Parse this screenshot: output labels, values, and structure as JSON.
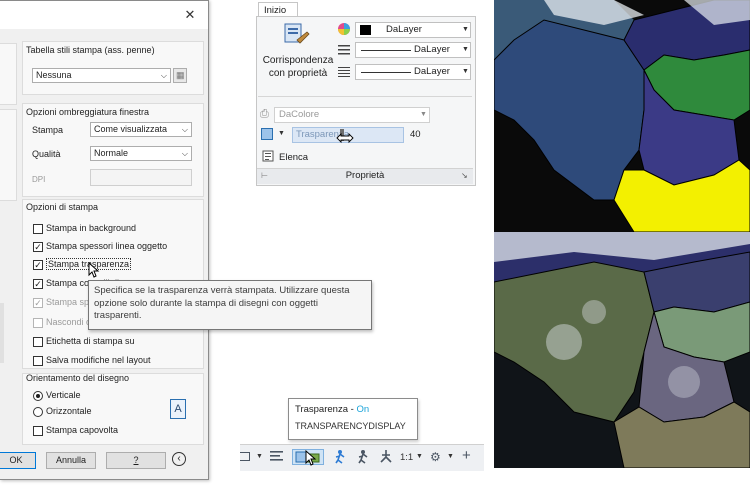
{
  "dialog": {
    "close_glyph": "✕",
    "pen_table": {
      "title": "Tabella stili stampa (ass. penne)",
      "value": "Nessuna"
    },
    "shading": {
      "title": "Opzioni ombreggiatura finestra",
      "stampa_label": "Stampa",
      "stampa_value": "Come visualizzata",
      "qualita_label": "Qualità",
      "qualita_value": "Normale",
      "dpi_label": "DPI"
    },
    "print_options": {
      "title": "Opzioni di stampa",
      "items": [
        {
          "label": "Stampa in background",
          "checked": false,
          "enabled": true
        },
        {
          "label": "Stampa spessori linea oggetto",
          "checked": true,
          "enabled": true
        },
        {
          "label": "Stampa trasparenza",
          "checked": true,
          "enabled": true
        },
        {
          "label": "Stampa con stili di stampa",
          "checked": true,
          "enabled": true
        },
        {
          "label": "Stampa spazio carta per ultimo",
          "checked": true,
          "enabled": false
        },
        {
          "label": "Nascondi oggetti spazio carta",
          "checked": false,
          "enabled": false
        },
        {
          "label": "Etichetta di stampa su",
          "checked": false,
          "enabled": true
        },
        {
          "label": "Salva modifiche nel layout",
          "checked": false,
          "enabled": true
        }
      ]
    },
    "orientation": {
      "title": "Orientamento del disegno",
      "vertical": "Verticale",
      "horizontal": "Orizzontale",
      "upside_down": "Stampa capovolta",
      "paper_glyph": "A"
    },
    "buttons": {
      "ok": "OK",
      "cancel": "Annulla",
      "help": "?",
      "more": "‹"
    }
  },
  "tooltip": {
    "text": "Specifica se la trasparenza verrà stampata. Utilizzare questa opzione solo durante la stampa di disegni con oggetti trasparenti."
  },
  "ribbon": {
    "tab": "Inizio",
    "match_properties_line1": "Corrispondenza",
    "match_properties_line2": "con proprietà",
    "color_value": "DaLayer",
    "linetype_value": "DaLayer",
    "lineweight_value": "DaLayer",
    "plotstyle_value": "DaColore",
    "transparency_label": "Trasparenza",
    "transparency_value": "40",
    "list_label": "Elenca",
    "panel_title": "Proprietà",
    "launcher_glyph": "↘"
  },
  "statusbar": {
    "scale": "1:1",
    "tooltip_title": "Trasparenza",
    "tooltip_sep": " - ",
    "tooltip_state": "On",
    "tooltip_command": "TRANSPARENCYDISPLAY"
  },
  "colors": {
    "accent_blue": "#0078d7",
    "on_cyan": "#1aa3d9",
    "region_blue": "#2e4a7a",
    "region_navy": "#3a3f9e",
    "region_green": "#2f8a3c",
    "region_yellow": "#f3f000",
    "region_purple": "#3b3a86"
  }
}
